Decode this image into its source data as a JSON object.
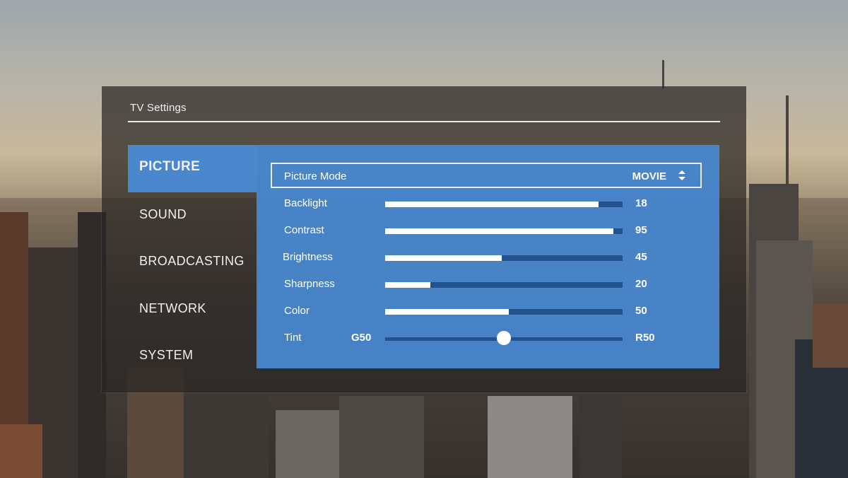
{
  "window": {
    "title": "TV Settings"
  },
  "nav": {
    "items": [
      {
        "label": "PICTURE",
        "active": true
      },
      {
        "label": "SOUND",
        "active": false
      },
      {
        "label": "BROADCASTING",
        "active": false
      },
      {
        "label": "NETWORK",
        "active": false
      },
      {
        "label": "SYSTEM",
        "active": false
      }
    ]
  },
  "picture": {
    "mode": {
      "label": "Picture Mode",
      "value": "MOVIE",
      "icon": "up-down-arrows-icon"
    },
    "settings": [
      {
        "label": "Backlight",
        "value": "18",
        "level": 0.9
      },
      {
        "label": "Contrast",
        "value": "95",
        "level": 0.96
      },
      {
        "label": "Brightness",
        "value": "45",
        "level": 0.49
      },
      {
        "label": "Sharpness",
        "value": "20",
        "level": 0.19
      },
      {
        "label": "Color",
        "value": "50",
        "level": 0.52
      }
    ],
    "tint": {
      "label": "Tint",
      "left_label": "G50",
      "right_label": "R50",
      "level": 0.5
    }
  },
  "colors": {
    "accent": "#4a8ad4",
    "track": "#23528c",
    "panel": "#282624"
  }
}
